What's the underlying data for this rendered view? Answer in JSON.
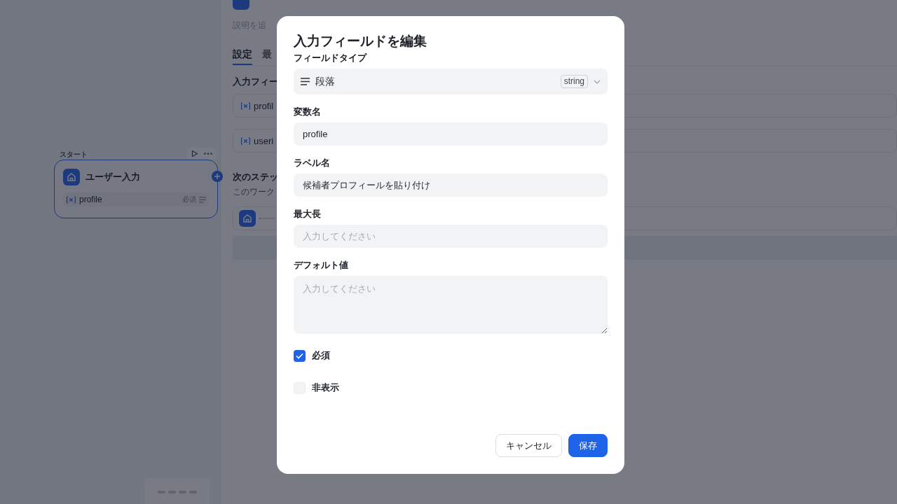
{
  "canvas": {
    "start_node": {
      "caption": "スタート",
      "title": "ユーザー入力",
      "variable": {
        "name": "profile",
        "badge": "必須"
      }
    }
  },
  "side_panel": {
    "description": "説明を追",
    "tabs": [
      {
        "label": "設定",
        "selected": true
      },
      {
        "label": "最",
        "selected": false
      }
    ],
    "section_title": "入力フィー",
    "fields": [
      "profil",
      "useri"
    ],
    "next_step": {
      "title": "次のステッ",
      "description": "このワーク"
    }
  },
  "dialog": {
    "title": "入力フィールドを編集",
    "field_type": {
      "label": "フィールドタイプ",
      "value": "段落",
      "type_badge": "string"
    },
    "variable_name": {
      "label": "変数名",
      "value": "profile"
    },
    "label_name": {
      "label": "ラベル名",
      "value": "候補者プロフィールを貼り付け"
    },
    "max_length": {
      "label": "最大長",
      "placeholder": "入力してください"
    },
    "default_value": {
      "label": "デフォルト値",
      "placeholder": "入力してください"
    },
    "checkboxes": [
      {
        "label": "必須",
        "checked": true
      },
      {
        "label": "非表示",
        "checked": false
      }
    ],
    "buttons": [
      {
        "label": "キャンセル",
        "kind": "secondary"
      },
      {
        "label": "保存",
        "kind": "primary"
      }
    ]
  }
}
